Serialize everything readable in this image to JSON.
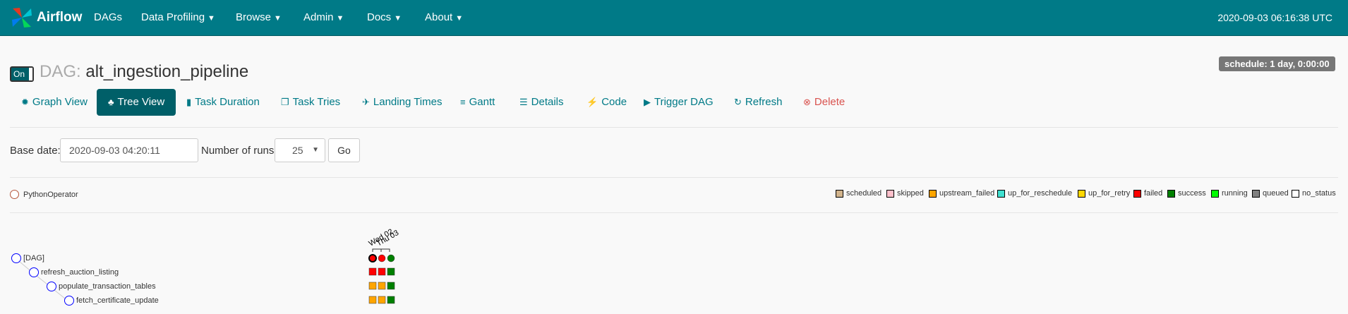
{
  "navbar": {
    "brand": "Airflow",
    "items": [
      {
        "label": "DAGs",
        "dropdown": false
      },
      {
        "label": "Data Profiling",
        "dropdown": true
      },
      {
        "label": "Browse",
        "dropdown": true
      },
      {
        "label": "Admin",
        "dropdown": true
      },
      {
        "label": "Docs",
        "dropdown": true
      },
      {
        "label": "About",
        "dropdown": true
      }
    ],
    "clock": "2020-09-03 06:16:38 UTC"
  },
  "dag": {
    "toggle": "On",
    "prefix": "DAG:",
    "id": "alt_ingestion_pipeline",
    "schedule": "schedule: 1 day, 0:00:00"
  },
  "tabs": [
    {
      "label": "Graph View",
      "icon": "asterisk-icon"
    },
    {
      "label": "Tree View",
      "icon": "tree-icon",
      "active": true
    },
    {
      "label": "Task Duration",
      "icon": "bar-chart-icon"
    },
    {
      "label": "Task Tries",
      "icon": "duplicate-icon"
    },
    {
      "label": "Landing Times",
      "icon": "plane-icon"
    },
    {
      "label": "Gantt",
      "icon": "align-left-icon"
    },
    {
      "label": "Details",
      "icon": "list-icon"
    },
    {
      "label": "Code",
      "icon": "flash-icon"
    },
    {
      "label": "Trigger DAG",
      "icon": "play-circle-icon"
    },
    {
      "label": "Refresh",
      "icon": "refresh-icon"
    },
    {
      "label": "Delete",
      "icon": "remove-circle-icon"
    }
  ],
  "form": {
    "base_date_label": "Base date:",
    "base_date_value": "2020-09-03 04:20:11",
    "runs_label": "Number of runs:",
    "runs_value": "25",
    "go_label": "Go"
  },
  "operator": {
    "label": "PythonOperator",
    "color": "#ffefeb"
  },
  "legend": [
    {
      "label": "scheduled",
      "color": "#d2b48c"
    },
    {
      "label": "skipped",
      "color": "#ffc0cb"
    },
    {
      "label": "upstream_failed",
      "color": "#ffa500"
    },
    {
      "label": "up_for_reschedule",
      "color": "#40e0d0"
    },
    {
      "label": "up_for_retry",
      "color": "#ffd700"
    },
    {
      "label": "failed",
      "color": "#ff0000"
    },
    {
      "label": "success",
      "color": "#008000"
    },
    {
      "label": "running",
      "color": "#00ff00"
    },
    {
      "label": "queued",
      "color": "#808080"
    },
    {
      "label": "no_status",
      "color": "#ffffff"
    }
  ],
  "tree": {
    "nodes": [
      "[DAG]",
      "refresh_auction_listing",
      "populate_transaction_tables",
      "fetch_certificate_update"
    ],
    "run_labels": [
      "Wed 02",
      "Thu 03"
    ],
    "grid": [
      [
        "failed",
        "failed",
        "success"
      ],
      [
        "failed",
        "failed",
        "success"
      ],
      [
        "upstream_failed",
        "upstream_failed",
        "success"
      ],
      [
        "upstream_failed",
        "upstream_failed",
        "success"
      ]
    ]
  }
}
